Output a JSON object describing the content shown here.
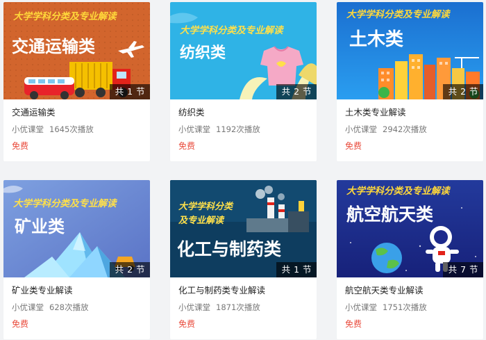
{
  "courses": [
    {
      "banner": "大学学科分类及专业解读",
      "big": "交通运输类",
      "badge": "共 1 节",
      "title": "交通运输类",
      "source": "小优课堂",
      "plays": "1645次播放",
      "price": "免费",
      "bg": "#d2652d"
    },
    {
      "banner": "大学学科分类及专业解读",
      "big": "纺织类",
      "badge": "共 2 节",
      "title": "纺织类",
      "source": "小优课堂",
      "plays": "1192次播放",
      "price": "免费",
      "bg": "#2fb3e6"
    },
    {
      "banner": "大学学科分类及专业解读",
      "big": "土木类",
      "badge": "共 2 节",
      "title": "土木类专业解读",
      "source": "小优课堂",
      "plays": "2942次播放",
      "price": "免费",
      "bg": "#1f7fd8"
    },
    {
      "banner": "大学学科分类及专业解读",
      "big": "矿业类",
      "badge": "共 2 节",
      "title": "矿业类专业解读",
      "source": "小优课堂",
      "plays": "628次播放",
      "price": "免费",
      "bg": "#6f8dd6"
    },
    {
      "banner": "大学学科分类及专业解读",
      "banner_line1": "大学学科分类",
      "banner_line2": "及专业解读",
      "big": "化工与制药类",
      "badge": "共 1 节",
      "title": "化工与制药类专业解读",
      "source": "小优课堂",
      "plays": "1871次播放",
      "price": "免费",
      "bg": "#0e3d5f"
    },
    {
      "banner": "大学学科分类及专业解读",
      "big": "航空航天类",
      "badge": "共 7 节",
      "title": "航空航天类专业解读",
      "source": "小优课堂",
      "plays": "1751次播放",
      "price": "免费",
      "bg": "#1d2a8c"
    }
  ]
}
